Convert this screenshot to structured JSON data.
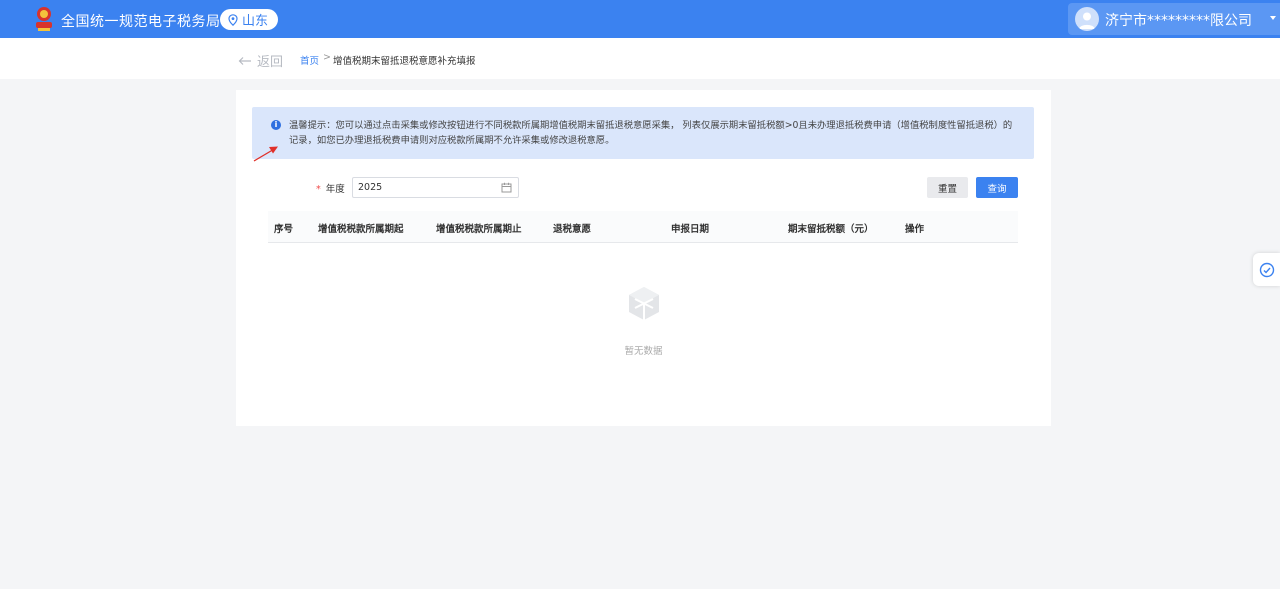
{
  "header": {
    "title": "全国统一规范电子税务局",
    "region": "山东",
    "user_name": "济宁市*********限公司",
    "brand_color": "#3b82f0"
  },
  "breadcrumb": {
    "back_label": "返回",
    "home": "首页",
    "separator": ">",
    "current": "增值税期末留抵退税意愿补充填报"
  },
  "notice": {
    "icon": "info-icon",
    "text": "温馨提示：您可以通过点击采集或修改按钮进行不同税款所属期增值税期末留抵退税意愿采集，  列表仅展示期末留抵税额>0且未办理退抵税费申请（增值税制度性留抵退税）的记录，如您已办理退抵税费申请则对应税款所属期不允许采集或修改退税意愿。"
  },
  "filter": {
    "required_mark": "*",
    "year_label": "年度",
    "year_value": "2025",
    "reset_label": "重置",
    "query_label": "查询"
  },
  "table": {
    "columns": [
      "序号",
      "增值税税款所属期起",
      "增值税税款所属期止",
      "退税意愿",
      "申报日期",
      "期末留抵税额（元）",
      "操作"
    ],
    "empty_text": "暂无数据"
  }
}
